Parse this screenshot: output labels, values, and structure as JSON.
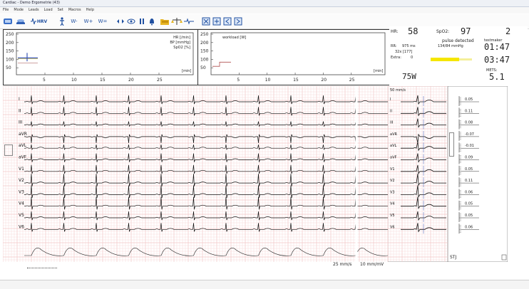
{
  "window": {
    "title": "Cardiac - Demo Ergometrie (43)"
  },
  "menu": [
    "File",
    "Mode",
    "Leads",
    "Load",
    "Set",
    "Macros",
    "Help"
  ],
  "toolbar": {
    "hrv": "HRV",
    "w_minus": "W-",
    "w_plus": "W+",
    "w_eq": "W="
  },
  "trend": {
    "labels": [
      "HR [/min]",
      "BP [mmHg]",
      "SpO2 [%]"
    ],
    "y_ticks": [
      "250",
      "200",
      "150",
      "100",
      "50"
    ],
    "x_ticks": [
      "5",
      "10",
      "15",
      "20",
      "25"
    ],
    "x_unit": "[min]"
  },
  "workload": {
    "label": "workload [W]",
    "y_ticks": [
      "250",
      "200",
      "150",
      "100",
      "50"
    ],
    "x_ticks": [
      "5",
      "10",
      "15",
      "20",
      "25"
    ],
    "x_unit": "[min]"
  },
  "vitals": {
    "hr_label": "HR:",
    "hr_value": "58",
    "spo2_label": "SpO2:",
    "spo2_value": "97",
    "stage_value": "2",
    "pulse_text": "pulse detected",
    "stage_label": "testmaker",
    "rr_label": "RR:",
    "rr_value": "975 ms",
    "rr_count": "32x [177]",
    "extra_label": "Extra:",
    "extra_value": "0",
    "bp_value": "134/84 mmHg",
    "time1": "01:47",
    "time2": "03:47",
    "mets_label": "METS:",
    "mets_value": "5.1",
    "load_value": "75W"
  },
  "ecg": {
    "leads": [
      "I",
      "II",
      "III",
      "aVR",
      "aVL",
      "aVF",
      "V1",
      "V2",
      "V3",
      "V4",
      "V5",
      "V6"
    ],
    "speed_label": "25 mm/s",
    "gain_label": "10 mm/mV",
    "median_header": "50 mm/s",
    "st_label": "STJ",
    "st_values": [
      "0.05",
      "0.11",
      "0.08",
      "-0.07",
      "-0.01",
      "0.09",
      "0.05",
      "0.11",
      "0.06",
      "0.05",
      "0.05",
      "0.06"
    ]
  },
  "colors": {
    "grid": "#f3c6c6",
    "grid_major": "#e99b9b",
    "trace": "#111111",
    "spo2_bar": "#f5e600"
  }
}
